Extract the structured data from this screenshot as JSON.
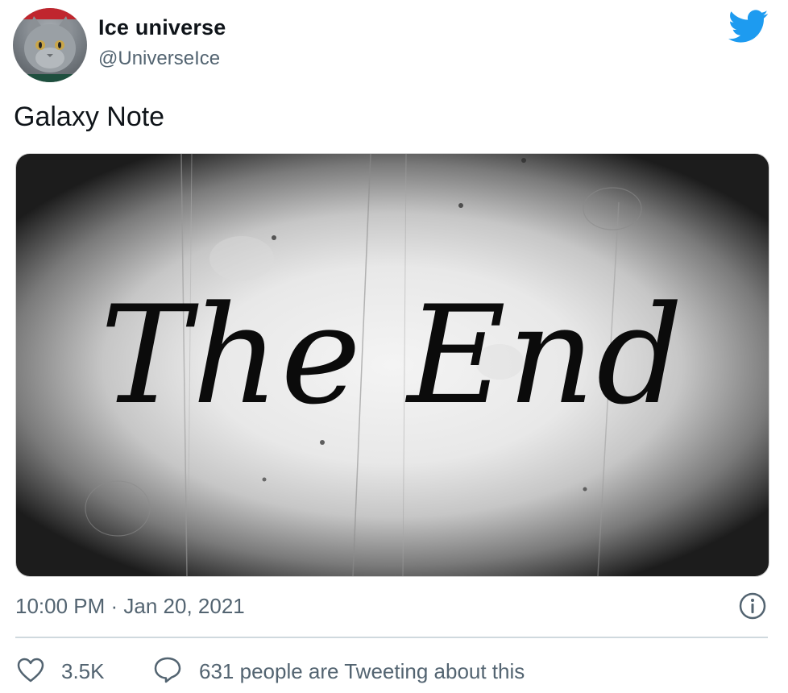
{
  "author": {
    "display_name": "Ice universe",
    "handle": "@UniverseIce",
    "avatar_icon": "cat-avatar"
  },
  "brand": {
    "logo_icon": "twitter-bird-icon",
    "color": "#1d9bf0"
  },
  "tweet": {
    "text": "Galaxy Note",
    "media": {
      "caption_text": "The End",
      "style": "old film title card, black and white vignette"
    },
    "timestamp": "10:00 PM · Jan 20, 2021"
  },
  "actions": {
    "like_count": "3.5K",
    "reply_text": "631 people are Tweeting about this"
  },
  "colors": {
    "text_primary": "#0f1419",
    "text_secondary": "#536471",
    "divider": "#cfd9de"
  }
}
